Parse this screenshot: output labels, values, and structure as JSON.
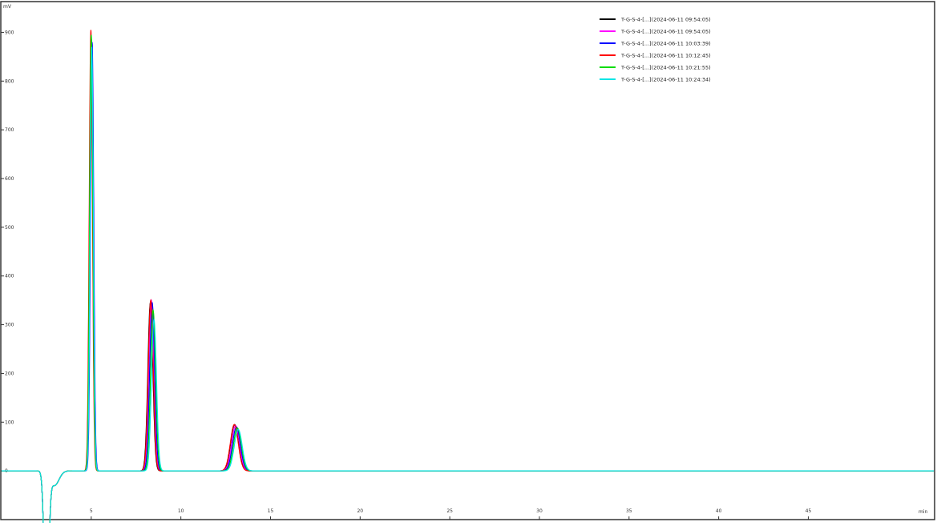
{
  "chart_data": {
    "type": "line",
    "title": "",
    "xlabel": "",
    "ylabel": "",
    "y_unit": "mV",
    "x_unit": "min",
    "xlim": [
      0,
      52
    ],
    "ylim": [
      -100,
      950
    ],
    "x_ticks": [
      5,
      10,
      15,
      20,
      25,
      30,
      35,
      40,
      45
    ],
    "x_tick_labels": [
      "5",
      "10",
      "15",
      "20",
      "25",
      "30",
      "35",
      "40",
      "45"
    ],
    "y_ticks": [
      -100,
      0,
      100,
      200,
      300,
      400,
      500,
      600,
      700,
      800,
      900
    ],
    "y_tick_labels": [
      "",
      "0",
      "100",
      "200",
      "300",
      "400",
      "500",
      "600",
      "700",
      "800",
      "900"
    ],
    "grid": false,
    "legend_position": "top-right",
    "series": [
      {
        "name": "T-G-S-4-[...](2024-06-11 09:54:05)",
        "color": "#000000",
        "peaks": [
          {
            "t": 5.0,
            "h": 890,
            "w": 0.09
          },
          {
            "t": 8.3,
            "h": 345,
            "w": 0.14
          },
          {
            "t": 13.0,
            "h": 95,
            "w": 0.22
          }
        ]
      },
      {
        "name": "T-G-S-4-[...](2024-06-11 09:54:05)",
        "color": "#ff00ff",
        "peaks": [
          {
            "t": 5.02,
            "h": 880,
            "w": 0.09
          },
          {
            "t": 8.35,
            "h": 350,
            "w": 0.14
          },
          {
            "t": 13.05,
            "h": 93,
            "w": 0.22
          }
        ]
      },
      {
        "name": "T-G-S-4-[...](2024-06-11 10:03:39)",
        "color": "#0000ff",
        "peaks": [
          {
            "t": 5.05,
            "h": 880,
            "w": 0.09
          },
          {
            "t": 8.4,
            "h": 345,
            "w": 0.14
          },
          {
            "t": 13.1,
            "h": 90,
            "w": 0.22
          }
        ]
      },
      {
        "name": "T-G-S-4-[...](2024-06-11 10:12:45)",
        "color": "#ff0000",
        "peaks": [
          {
            "t": 4.98,
            "h": 905,
            "w": 0.09
          },
          {
            "t": 8.32,
            "h": 350,
            "w": 0.14
          },
          {
            "t": 12.98,
            "h": 95,
            "w": 0.22
          }
        ]
      },
      {
        "name": "T-G-S-4-[...](2024-06-11 10:21:55)",
        "color": "#00dd00",
        "peaks": [
          {
            "t": 5.0,
            "h": 895,
            "w": 0.09
          },
          {
            "t": 8.45,
            "h": 330,
            "w": 0.14
          },
          {
            "t": 13.15,
            "h": 88,
            "w": 0.22
          }
        ]
      },
      {
        "name": "T-G-S-4-[...](2024-06-11 10:24:34)",
        "color": "#00e5e5",
        "peaks": [
          {
            "t": 5.03,
            "h": 870,
            "w": 0.09
          },
          {
            "t": 8.5,
            "h": 310,
            "w": 0.14
          },
          {
            "t": 13.2,
            "h": 85,
            "w": 0.22
          }
        ]
      }
    ],
    "dip": {
      "t": 2.5,
      "h": -320,
      "w": 0.12
    }
  }
}
